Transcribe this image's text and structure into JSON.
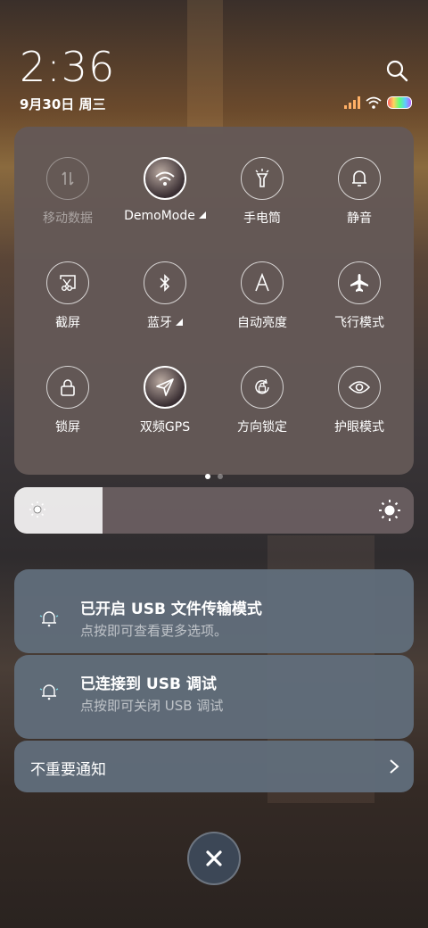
{
  "status": {
    "time": "2:36",
    "date": "9月30日 周三",
    "icons": [
      "signal-icon",
      "wifi-icon",
      "battery-icon"
    ]
  },
  "quick_settings": {
    "tiles": [
      {
        "label": "移动数据",
        "icon": "mobile-data-icon",
        "state": "disabled"
      },
      {
        "label": "DemoMode",
        "icon": "wifi-icon",
        "state": "active"
      },
      {
        "label": "手电筒",
        "icon": "flashlight-icon",
        "state": "off"
      },
      {
        "label": "静音",
        "icon": "bell-icon",
        "state": "off"
      },
      {
        "label": "截屏",
        "icon": "screenshot-icon",
        "state": "off"
      },
      {
        "label": "蓝牙",
        "icon": "bluetooth-icon",
        "state": "off"
      },
      {
        "label": "自动亮度",
        "icon": "auto-brightness-icon",
        "state": "off"
      },
      {
        "label": "飞行模式",
        "icon": "airplane-icon",
        "state": "off"
      },
      {
        "label": "锁屏",
        "icon": "lock-icon",
        "state": "off"
      },
      {
        "label": "双频GPS",
        "icon": "gps-icon",
        "state": "active"
      },
      {
        "label": "方向锁定",
        "icon": "rotation-lock-icon",
        "state": "off"
      },
      {
        "label": "护眼模式",
        "icon": "eye-icon",
        "state": "off"
      }
    ],
    "page_count": 2,
    "current_page": 1
  },
  "brightness": {
    "level": 0.22
  },
  "notifications": [
    {
      "title": "已开启 USB 文件传输模式",
      "subtitle": "点按即可查看更多选项。",
      "icon": "notification-bell-icon"
    },
    {
      "title": "已连接到 USB 调试",
      "subtitle": "点按即可关闭 USB 调试",
      "icon": "notification-bell-icon"
    }
  ],
  "unimportant": {
    "label": "不重要通知"
  },
  "colors": {
    "panel": "#645856",
    "notification": "#606c7a",
    "close_button": "#3c4756"
  }
}
